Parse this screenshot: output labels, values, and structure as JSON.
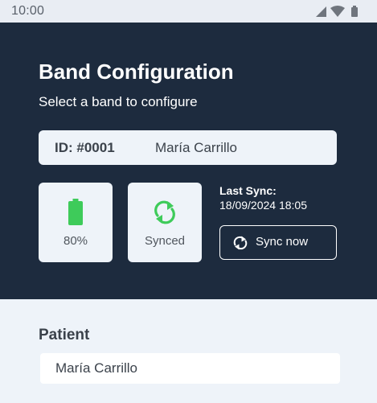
{
  "status_bar": {
    "time": "10:00",
    "icons": [
      "signal-icon",
      "wifi-icon",
      "battery-icon"
    ]
  },
  "header": {
    "title": "Band Configuration",
    "subtitle": "Select a band to configure"
  },
  "band": {
    "id_label": "ID: #0001",
    "name": "María Carrillo"
  },
  "tiles": {
    "battery": {
      "icon": "battery-full-icon",
      "label": "80%",
      "color": "#3ecb5a"
    },
    "sync_status": {
      "icon": "sync-icon",
      "label": "Synced",
      "color": "#3ecb5a"
    }
  },
  "sync": {
    "title": "Last Sync:",
    "date": "18/09/2024 18:05",
    "button_label": "Sync now",
    "button_icon": "sync-icon"
  },
  "patient": {
    "label": "Patient",
    "value": "María Carrillo"
  },
  "colors": {
    "header_bg": "#1d2b3e",
    "page_bg": "#eef3f9",
    "accent_green": "#3ecb5a"
  }
}
